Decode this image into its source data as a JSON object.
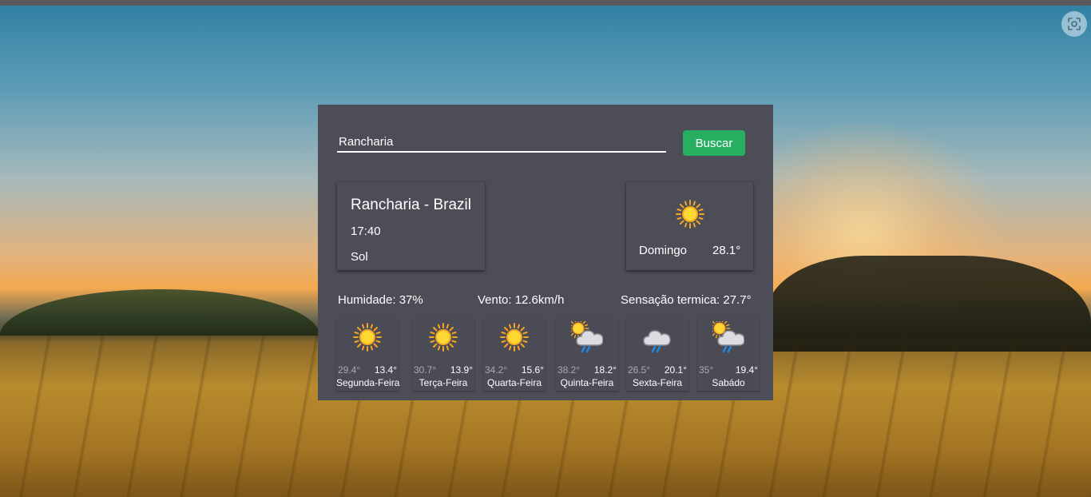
{
  "search": {
    "value": "Rancharia",
    "button_label": "Buscar"
  },
  "current": {
    "location": "Rancharia - Brazil",
    "time": "17:40",
    "condition": "Sol"
  },
  "today": {
    "icon": "sun-icon",
    "day": "Domingo",
    "temp": "28.1°"
  },
  "stats": {
    "humidity": "Humidade: 37%",
    "wind": "Vento: 12.6km/h",
    "feels_like": "Sensação termica: 27.7°"
  },
  "forecast": [
    {
      "day": "Segunda-Feira",
      "max": "29.4°",
      "min": "13.4°",
      "icon": "sun-icon"
    },
    {
      "day": "Terça-Feira",
      "max": "30.7°",
      "min": "13.9°",
      "icon": "sun-icon"
    },
    {
      "day": "Quarta-Feira",
      "max": "34.2°",
      "min": "15.6°",
      "icon": "sun-icon"
    },
    {
      "day": "Quinta-Feira",
      "max": "38.2°",
      "min": "18.2°",
      "icon": "sun-cloud-rain-icon"
    },
    {
      "day": "Sexta-Feira",
      "max": "26.5°",
      "min": "20.1°",
      "icon": "cloud-rain-icon"
    },
    {
      "day": "Sabádo",
      "max": "35°",
      "min": "19.4°",
      "icon": "sun-cloud-rain-icon"
    }
  ],
  "colors": {
    "card_bg": "#4d4d57",
    "button_green": "#27ae60",
    "sun_yellow": "#fbc02d",
    "rain_blue": "#1e88e5"
  }
}
